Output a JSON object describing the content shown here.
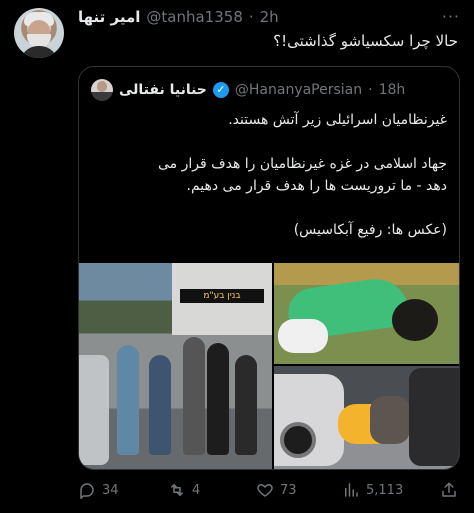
{
  "tweet": {
    "author": {
      "name": "امیر تنها",
      "handle": "@tanha1358",
      "time": "2h"
    },
    "text": "حالا چرا سکسیاشو گذاشتی!؟",
    "quote": {
      "author": {
        "name": "حنانیا نفتالی",
        "handle": "@HananyaPersian",
        "time": "18h"
      },
      "lines": [
        "غیرنظامیان اسرائیلی زیر آتش هستند.",
        "",
        "جهاد اسلامی در غزه غیرنظامیان را هدف قرار می",
        "دهد - ما تروریست ها را هدف قرار می دهیم.",
        "",
        "(عکس ها: رفیع آبکاسیس)"
      ],
      "bus_sign": "בנין בע\"מ"
    },
    "stats": {
      "replies": "34",
      "reposts": "4",
      "likes": "73",
      "views": "5,113"
    }
  },
  "colors": {
    "background": "#000000",
    "text": "#e7e9ea",
    "muted": "#71767b",
    "verified": "#1d9bf0",
    "border": "#2f3336"
  },
  "icons": [
    "more-icon",
    "verified-icon",
    "reply-icon",
    "repost-icon",
    "like-icon",
    "views-icon",
    "share-icon"
  ]
}
